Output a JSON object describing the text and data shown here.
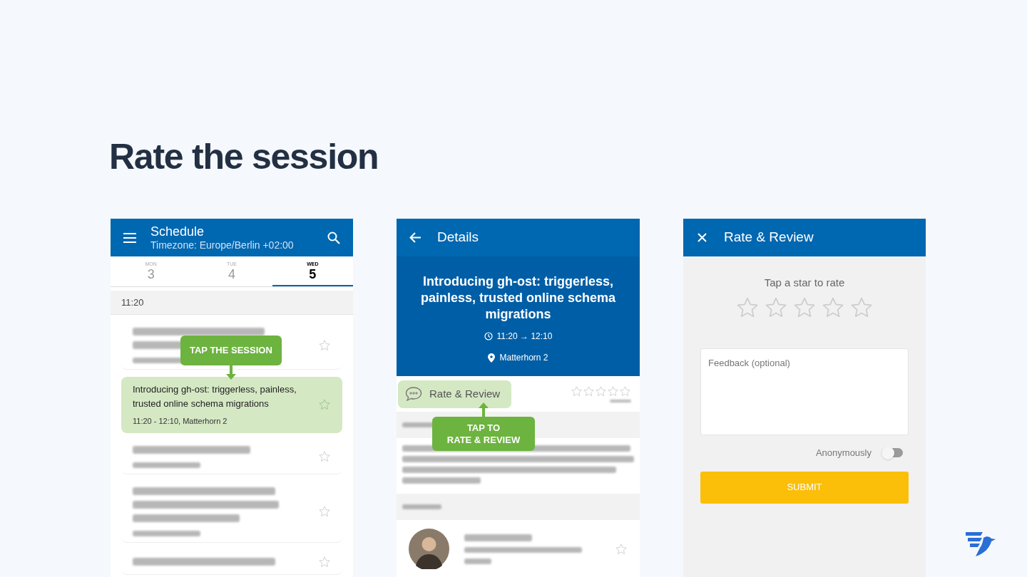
{
  "heading": "Rate the session",
  "schedule": {
    "title": "Schedule",
    "subtitle": "Timezone: Europe/Berlin +02:00",
    "days": [
      {
        "weekday": "MON",
        "day": "3",
        "selected": false
      },
      {
        "weekday": "TUE",
        "day": "4",
        "selected": false
      },
      {
        "weekday": "WED",
        "day": "5",
        "selected": true
      }
    ],
    "time_slot": "11:20",
    "sessions": [
      {
        "kind": "blurred",
        "selected": false
      },
      {
        "kind": "session",
        "title": "Introducing gh-ost: triggerless, painless, trusted online schema migrations",
        "meta": "11:20 - 12:10, Matterhorn 2",
        "selected": true
      },
      {
        "kind": "blurred",
        "selected": false
      },
      {
        "kind": "blurred",
        "selected": false
      },
      {
        "kind": "blurred",
        "selected": false
      }
    ],
    "callout": "TAP THE SESSION"
  },
  "details": {
    "title": "Details",
    "session_title": "Introducing gh-ost: triggerless, painless, trusted online schema migrations",
    "time": "11:20 → 12:10",
    "room": "Matterhorn 2",
    "rate_button": "Rate & Review",
    "rating": {
      "stars": 0
    },
    "callout": [
      "TAP TO",
      "RATE & REVIEW"
    ]
  },
  "rate": {
    "title": "Rate & Review",
    "prompt": "Tap a star to rate",
    "stars": 0,
    "feedback_placeholder": "Feedback (optional)",
    "anonymous_label": "Anonymously",
    "anonymous_on": false,
    "submit": "SUBMIT"
  }
}
